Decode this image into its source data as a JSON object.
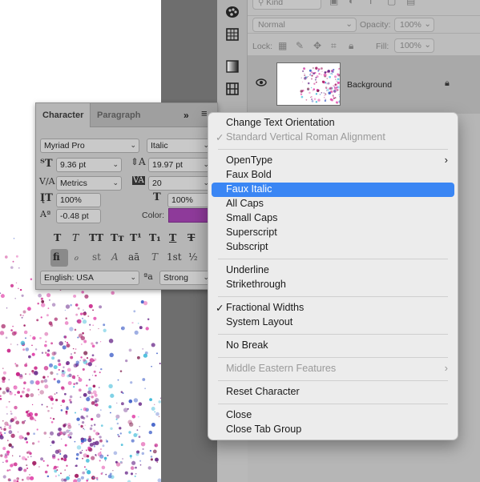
{
  "layers_panel": {
    "filter_kind": "Kind",
    "blend_mode": "Normal",
    "opacity_label": "Opacity:",
    "opacity_value": "100%",
    "lock_label": "Lock:",
    "fill_label": "Fill:",
    "fill_value": "100%",
    "layer_name": "Background"
  },
  "character_panel": {
    "tabs": [
      "Character",
      "Paragraph"
    ],
    "font_family": "Myriad Pro",
    "font_style": "Italic",
    "font_size": "9.36 pt",
    "leading": "19.97 pt",
    "kerning": "Metrics",
    "tracking": "20",
    "vertical_scale": "100%",
    "horizontal_scale": "100%",
    "baseline_shift": "-0.48 pt",
    "color_label": "Color:",
    "color_value": "#8e3a9a",
    "style_buttons": [
      "T",
      "T",
      "TT",
      "Tт",
      "T¹",
      "T₁",
      "T",
      "T"
    ],
    "ligature_buttons": [
      "fi",
      "ℴ",
      "st",
      "A",
      "aā",
      "T",
      "1st",
      "½"
    ],
    "language": "English: USA",
    "aa_label": "ªa",
    "antialias": "Strong"
  },
  "context_menu": {
    "items": [
      {
        "label": "Change Text Orientation"
      },
      {
        "label": "Standard Vertical Roman Alignment",
        "check": "✓",
        "disabled": true
      },
      {
        "label": "OpenType",
        "submenu": "›"
      },
      {
        "label": "Faux Bold"
      },
      {
        "label": "Faux Italic",
        "highlighted": true
      },
      {
        "label": "All Caps"
      },
      {
        "label": "Small Caps"
      },
      {
        "label": "Superscript"
      },
      {
        "label": "Subscript"
      },
      {
        "label": "Underline"
      },
      {
        "label": "Strikethrough"
      },
      {
        "label": "Fractional Widths",
        "check": "✓"
      },
      {
        "label": "System Layout"
      },
      {
        "label": "No Break"
      },
      {
        "label": "Middle Eastern Features",
        "disabled": true,
        "submenu": "›"
      },
      {
        "label": "Reset Character"
      },
      {
        "label": "Close"
      },
      {
        "label": "Close Tab Group"
      }
    ]
  },
  "colors": {
    "menu_highlight": "#3a86f4",
    "swatch": "#8e3a9a"
  }
}
